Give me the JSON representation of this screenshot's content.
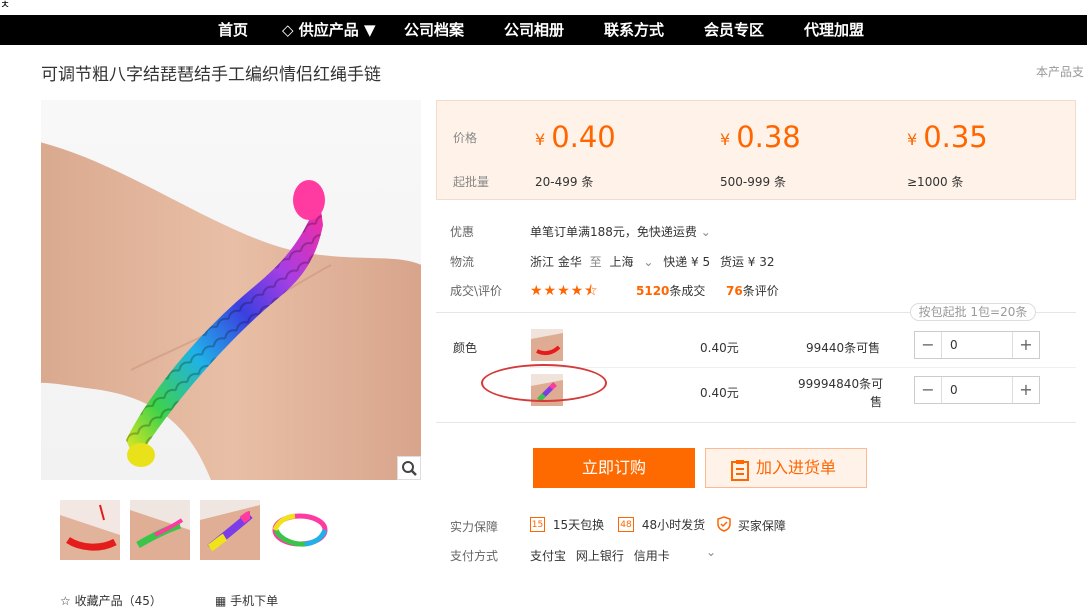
{
  "top_mark": "ㅊ",
  "nav": {
    "items": [
      "首页",
      "◇ 供应产品 ▼",
      "公司档案",
      "公司相册",
      "联系方式",
      "会员专区",
      "代理加盟"
    ]
  },
  "product": {
    "title": "可调节粗八字结琵琶结手工编织情侣红绳手链",
    "support_text": "本产品支"
  },
  "price_table": {
    "price_label": "价格",
    "min_qty_label": "起批量",
    "currency": "¥",
    "tiers": [
      {
        "price": "0.40",
        "qty": "20-499 条"
      },
      {
        "price": "0.38",
        "qty": "500-999 条"
      },
      {
        "price": "0.35",
        "qty": "≥1000 条"
      }
    ]
  },
  "info": {
    "discount_label": "优惠",
    "discount_text": "单笔订单满188元，免快递运费",
    "logistics_label": "物流",
    "from": "浙江 金华",
    "to_word": "至",
    "dest": "上海",
    "express": "快递 ¥ 5",
    "freight": "货运 ¥ 32",
    "deals_label": "成交\\评价",
    "deals_count": "5120",
    "deals_unit": "条成交",
    "reviews_count": "76",
    "reviews_unit": "条评价",
    "rating": 4.5
  },
  "sku": {
    "pack_note": "按包起批 1包=20条",
    "color_label": "颜色",
    "rows": [
      {
        "price": "0.40元",
        "stock": "99440条可售",
        "qty": "0"
      },
      {
        "price": "0.40元",
        "stock_line1": "99994840条可",
        "stock_line2": "售",
        "qty": "0"
      }
    ],
    "minus": "−",
    "plus": "+"
  },
  "actions": {
    "order": "立即订购",
    "cart": "加入进货单"
  },
  "guarantee": {
    "label": "实力保障",
    "items": [
      "15天包换",
      "48小时发货",
      "买家保障"
    ],
    "badge_15": "15",
    "badge_48": "48"
  },
  "payment": {
    "label": "支付方式",
    "methods": [
      "支付宝",
      "网上银行",
      "信用卡"
    ]
  },
  "bottom": {
    "favorite": "收藏产品（45）",
    "mobile": "手机下单"
  },
  "colors": {
    "accent": "#ff6a00",
    "price_bg": "#fff2e8",
    "nav_bg": "#000000",
    "highlight_circle": "#d43a3a"
  }
}
